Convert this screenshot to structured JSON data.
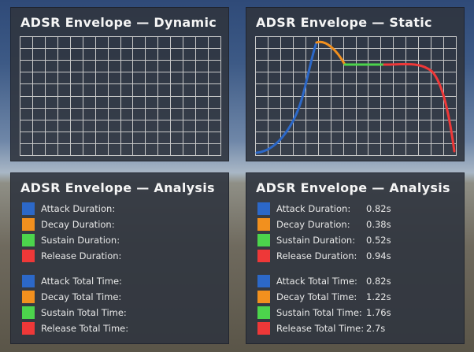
{
  "colors": {
    "attack": "#2c68c8",
    "decay": "#f2901e",
    "sustain": "#4cd44c",
    "release": "#ee3838",
    "grid": "#c8c8c8"
  },
  "panels": {
    "dynamic": {
      "title": "ADSR Envelope — Dynamic"
    },
    "static": {
      "title": "ADSR Envelope — Static"
    },
    "analysis_left": {
      "title": "ADSR Envelope — Analysis",
      "durations": [
        {
          "label": "Attack Duration:",
          "value": ""
        },
        {
          "label": "Decay Duration:",
          "value": ""
        },
        {
          "label": "Sustain Duration:",
          "value": ""
        },
        {
          "label": "Release Duration:",
          "value": ""
        }
      ],
      "totals": [
        {
          "label": "Attack Total Time:",
          "value": ""
        },
        {
          "label": "Decay Total Time:",
          "value": ""
        },
        {
          "label": "Sustain Total Time:",
          "value": ""
        },
        {
          "label": "Release Total Time:",
          "value": ""
        }
      ]
    },
    "analysis_right": {
      "title": "ADSR Envelope — Analysis",
      "durations": [
        {
          "label": "Attack Duration:",
          "value": "0.82s"
        },
        {
          "label": "Decay Duration:",
          "value": "0.38s"
        },
        {
          "label": "Sustain Duration:",
          "value": "0.52s"
        },
        {
          "label": "Release Duration:",
          "value": "0.94s"
        }
      ],
      "totals": [
        {
          "label": "Attack Total Time:",
          "value": "0.82s"
        },
        {
          "label": "Decay Total Time:",
          "value": "1.22s"
        },
        {
          "label": "Sustain Total Time:",
          "value": "1.76s"
        },
        {
          "label": "Release Total Time:",
          "value": "2.7s"
        }
      ]
    }
  }
}
